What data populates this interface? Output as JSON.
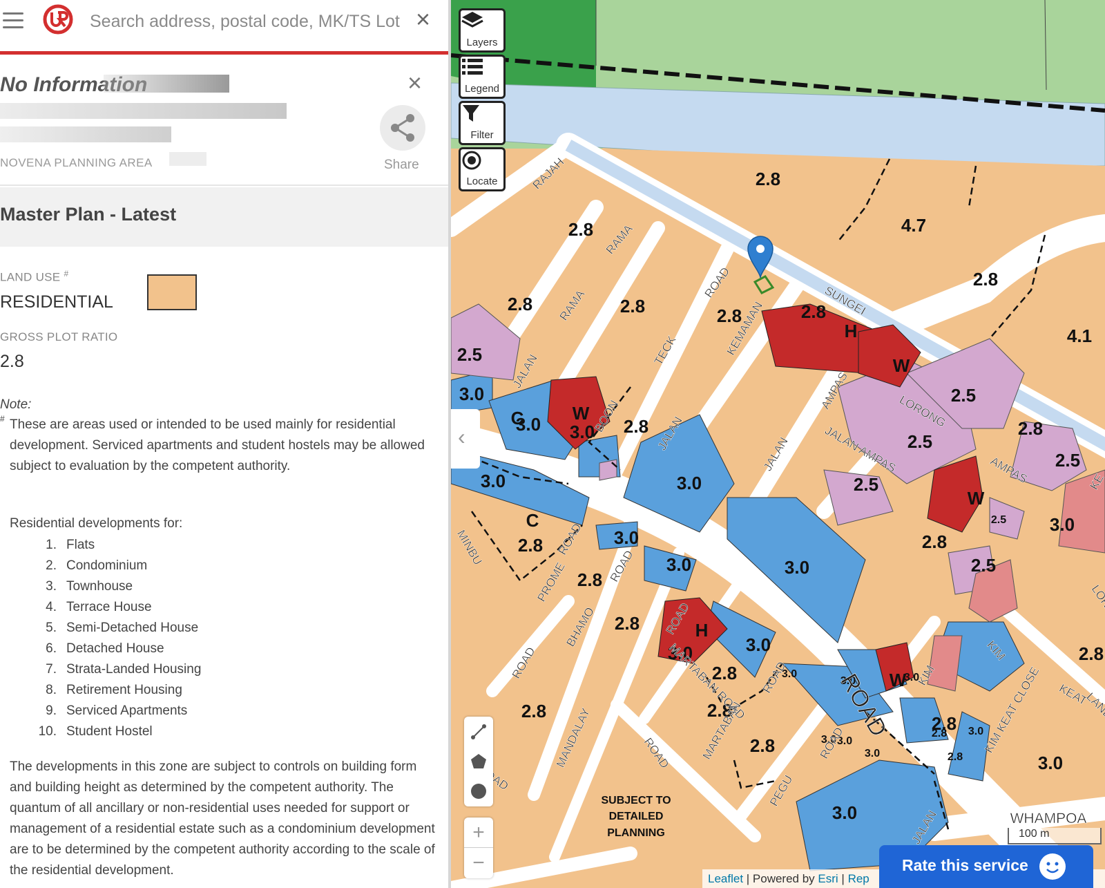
{
  "search": {
    "placeholder": "Search address, postal code, MK/TS Lot",
    "clear_icon": "close-icon"
  },
  "info": {
    "title": "No Information",
    "planning_area": "NOVENA PLANNING AREA",
    "share_label": "Share"
  },
  "master_plan": {
    "heading": "Master Plan - Latest",
    "land_use_label": "LAND USE",
    "land_use_mark": "#",
    "land_use_value": "RESIDENTIAL",
    "land_use_color": "#f2c28c",
    "gpr_label": "GROSS PLOT RATIO",
    "gpr_value": "2.8",
    "note_label": "Note:",
    "note_mark": "#",
    "note_text": "These are areas used or intended to be used mainly for residential development. Serviced apartments and student hostels may be allowed subject to evaluation by the competent authority.",
    "dev_intro": "Residential developments for:",
    "dev_types": [
      {
        "num": "1.",
        "label": "Flats"
      },
      {
        "num": "2.",
        "label": "Condominium"
      },
      {
        "num": "3.",
        "label": "Townhouse"
      },
      {
        "num": "4.",
        "label": "Terrace House"
      },
      {
        "num": "5.",
        "label": "Semi-Detached House"
      },
      {
        "num": "6.",
        "label": "Detached House"
      },
      {
        "num": "7.",
        "label": "Strata-Landed Housing"
      },
      {
        "num": "8.",
        "label": "Retirement Housing"
      },
      {
        "num": "9.",
        "label": "Serviced Apartments"
      },
      {
        "num": "10.",
        "label": "Student Hostel"
      }
    ],
    "controls_text": "The developments in this zone are subject to controls on building form and building height as determined by the competent authority. The quantum of all ancillary or non-residential uses needed for support or management of a residential estate such as a condominium development are to be determined by the competent authority according to the scale of the residential development."
  },
  "map": {
    "controls": [
      {
        "label": "Layers",
        "icon": "layers-icon"
      },
      {
        "label": "Legend",
        "icon": "list-icon"
      },
      {
        "label": "Filter",
        "icon": "filter-icon"
      },
      {
        "label": "Locate",
        "icon": "locate-icon"
      }
    ],
    "zoom_in": "+",
    "zoom_out": "−",
    "scale_label": "100 m",
    "attribution": {
      "leaflet": "Leaflet",
      "sep1": " | Powered by ",
      "esri": "Esri",
      "sep2": " | ",
      "rest": "Rep"
    },
    "rate_label": "Rate this service",
    "colors": {
      "residential": "#f2c28c",
      "commercial_institution": "#5aa0dc",
      "white": "#c42a2a",
      "mixed": "#d3a8cf",
      "park": "#4aa64a",
      "waterbody": "#c5daf0",
      "reserve": "#a9d49b",
      "road": "#ffffff"
    },
    "plot_labels": [
      "2.8",
      "4.7",
      "2.8",
      "2.8",
      "2.8",
      "2.8",
      "2.8",
      "2.8",
      "4.1",
      "2.5",
      "3.0",
      "3.0",
      "2.8",
      "2.5",
      "2.5",
      "2.8",
      "2.5",
      "2.5",
      "3.0",
      "3.0",
      "3.0",
      "2.8",
      "2.8",
      "2.8",
      "2.5",
      "3.0",
      "3.0",
      "2.8",
      "2.8",
      "2.8",
      "2.8",
      "2.8",
      "2.8",
      "3.0",
      "3.0",
      "3.0",
      "3.0",
      "3.0",
      "2.8",
      "3.0",
      "2.8",
      "3.0",
      "3.0",
      "3.0",
      "3.0",
      "3.0",
      "3.0",
      "3.0",
      "2.8",
      "2.5"
    ],
    "zone_letters": [
      "H",
      "W",
      "W",
      "W",
      "C",
      "C",
      "H",
      "W"
    ],
    "road_labels": [
      "RAJAH",
      "RAMA",
      "RAMA",
      "ROAD",
      "JALAN",
      "SUNGEI",
      "KEMAMAN",
      "TECK",
      "JALAN",
      "BOON",
      "JALAN",
      "AMPAS",
      "LORONG",
      "JALAN AMPAS",
      "AMPAS",
      "KE",
      "MINBU",
      "ROAD",
      "PROME",
      "ROAD",
      "BHAMO",
      "ROAD",
      "MARTABAN ROAD",
      "ROAD",
      "ROAD",
      "MARTABAN",
      "ROAD",
      "PEGU",
      "MANDALAY",
      "ROAD",
      "ROAD",
      "KIM",
      "KIM",
      "KIM KEAT CLOSE",
      "KEAT",
      "LANE",
      "LOR",
      "WHAMPOA",
      "ROAD",
      "JALAN"
    ],
    "special_note": [
      "SUBJECT TO",
      "DETAILED",
      "PLANNING"
    ]
  }
}
